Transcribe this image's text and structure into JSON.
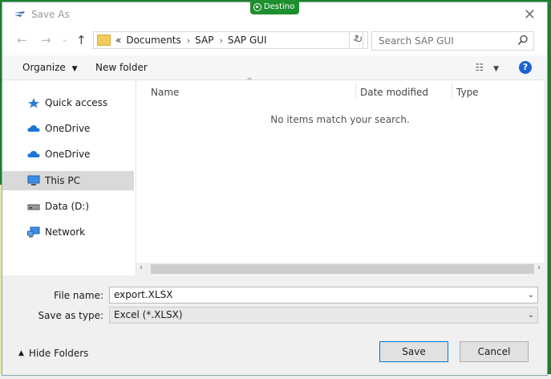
{
  "window": {
    "title": "Save As",
    "badge": "Destino"
  },
  "nav": {
    "breadcrumb_prefix": "«",
    "breadcrumbs": [
      "Documents",
      "SAP",
      "SAP GUI"
    ],
    "search_placeholder": "Search SAP GUI"
  },
  "toolbar": {
    "organize_label": "Organize",
    "new_folder_label": "New folder"
  },
  "sidebar": {
    "items": [
      {
        "label": "Quick access",
        "icon": "star-icon"
      },
      {
        "label": "OneDrive",
        "icon": "cloud-icon"
      },
      {
        "label": "OneDrive",
        "icon": "cloud-icon"
      },
      {
        "label": "This PC",
        "icon": "computer-icon",
        "selected": true
      },
      {
        "label": "Data (D:)",
        "icon": "drive-icon"
      },
      {
        "label": "Network",
        "icon": "network-icon"
      }
    ]
  },
  "file_list": {
    "columns": [
      "Name",
      "Date modified",
      "Type"
    ],
    "empty_message": "No items match your search."
  },
  "form": {
    "file_name_label": "File name:",
    "file_name_value": "export.XLSX",
    "save_type_label": "Save as type:",
    "save_type_value": "Excel (*.XLSX)"
  },
  "footer": {
    "hide_folders_label": "Hide Folders",
    "save_label": "Save",
    "cancel_label": "Cancel"
  },
  "colors": {
    "accent": "#0078d7",
    "help_blue": "#1a64d0",
    "frame_green": "#1e7d2a"
  }
}
